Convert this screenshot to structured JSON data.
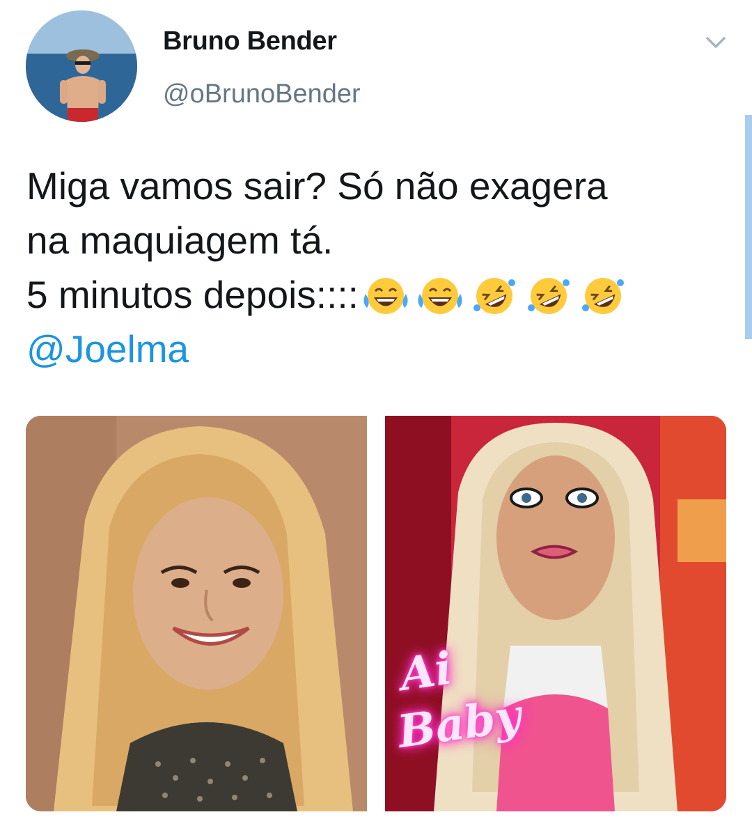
{
  "tweet": {
    "author": {
      "display_name": "Bruno Bender",
      "handle": "@oBrunoBender",
      "avatar_icon": "profile-avatar"
    },
    "menu_icon": "chevron-down-icon",
    "text_lines": [
      "Miga vamos sair? Só não exagera",
      "na maquiagem tá.",
      "5 minutos depois::::"
    ],
    "emojis": [
      "😂",
      "😂",
      "🤣",
      "🤣",
      "🤣"
    ],
    "mention": "@Joelma",
    "images": [
      {
        "icon": "photo-before",
        "description_name": "photo-natural-makeup"
      },
      {
        "icon": "photo-after",
        "neon_line_1": "Ai",
        "neon_line_2": "Baby"
      }
    ]
  },
  "colors": {
    "text": "#14171a",
    "secondary": "#657786",
    "link": "#1b95e0",
    "scrollbar": "#a8cdee"
  }
}
